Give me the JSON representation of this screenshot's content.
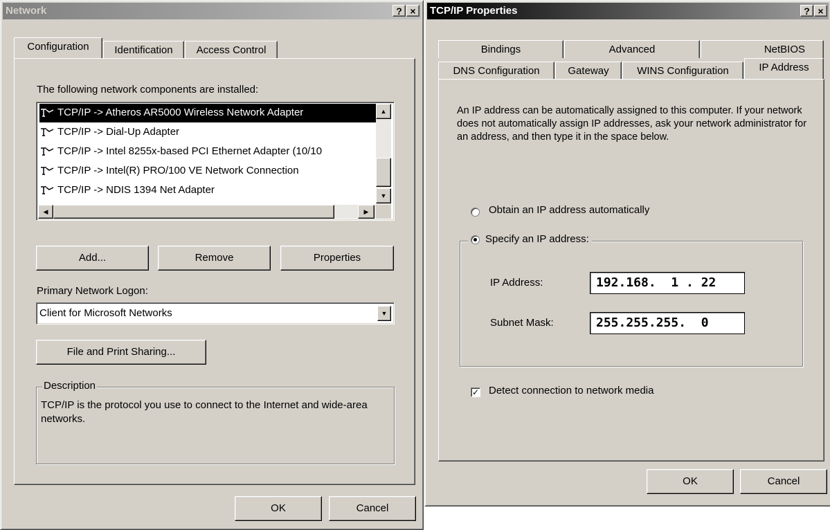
{
  "network_dialog": {
    "title": "Network",
    "help_btn": "?",
    "close_btn": "×",
    "tabs": [
      {
        "label": "Configuration"
      },
      {
        "label": "Identification"
      },
      {
        "label": "Access Control"
      }
    ],
    "components_label": "The following network components are installed:",
    "components": [
      "TCP/IP -> Atheros AR5000 Wireless Network Adapter",
      "TCP/IP -> Dial-Up Adapter",
      "TCP/IP -> Intel 8255x-based PCI Ethernet Adapter (10/10",
      "TCP/IP -> Intel(R) PRO/100 VE Network Connection",
      "TCP/IP -> NDIS 1394 Net Adapter"
    ],
    "selected_component_index": 0,
    "add_button": "Add...",
    "remove_button": "Remove",
    "properties_button": "Properties",
    "logon_label": "Primary Network Logon:",
    "logon_value": "Client for Microsoft Networks",
    "file_print_button": "File and Print Sharing...",
    "description_title": "Description",
    "description_text": "TCP/IP is the protocol you use to connect to the Internet and wide-area networks.",
    "ok_button": "OK",
    "cancel_button": "Cancel"
  },
  "tcpip_dialog": {
    "title": "TCP/IP Properties",
    "help_btn": "?",
    "close_btn": "×",
    "tabs_back": [
      {
        "label": "Bindings"
      },
      {
        "label": "Advanced"
      },
      {
        "label": "NetBIOS"
      }
    ],
    "tabs_front": [
      {
        "label": "DNS Configuration"
      },
      {
        "label": "Gateway"
      },
      {
        "label": "WINS Configuration"
      },
      {
        "label": "IP Address"
      }
    ],
    "intro_text": "An IP address can be automatically assigned to this computer. If your network does not automatically assign IP addresses, ask your network administrator for an address, and then type it in the space below.",
    "radio_obtain": "Obtain an IP address automatically",
    "radio_specify": "Specify an IP address:",
    "specify_selected": true,
    "ip_label": "IP Address:",
    "ip_value": "192.168.  1 . 22",
    "subnet_label": "Subnet Mask:",
    "subnet_value": "255.255.255.  0",
    "detect_label": "Detect connection to network media",
    "detect_checked": true,
    "ok_button": "OK",
    "cancel_button": "Cancel"
  },
  "colors": {
    "face": "#d4d0c8",
    "selection": "#000000",
    "title_active": "#000000",
    "title_inactive": "#808080"
  }
}
